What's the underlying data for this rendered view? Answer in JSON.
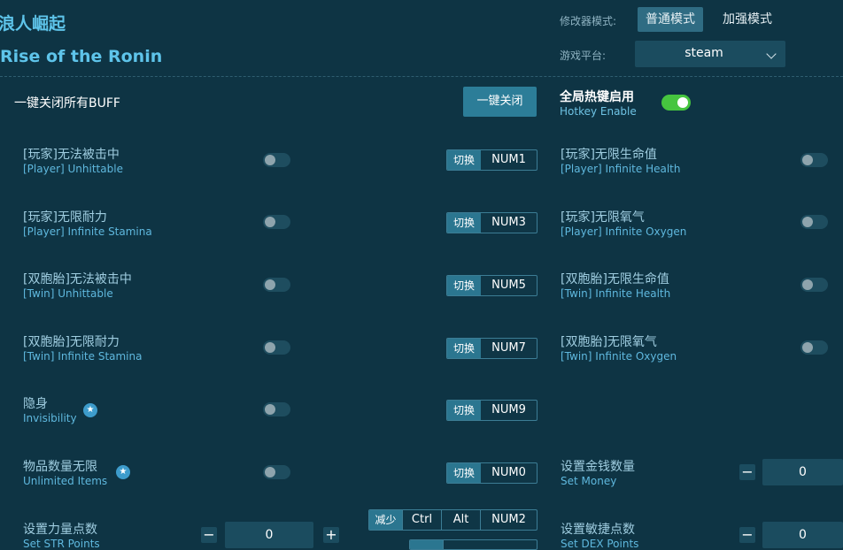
{
  "header": {
    "title_cn": "浪人崛起",
    "title_en": "Rise of the Ronin",
    "mode_label": "修改器模式:",
    "mode_normal": "普通模式",
    "mode_enhanced": "加强模式",
    "platform_label": "游戏平台:",
    "platform_value": "steam"
  },
  "controls": {
    "close_all_label": "一键关闭所有BUFF",
    "close_all_button": "一键关闭",
    "hotkey_enable_cn": "全局热键启用",
    "hotkey_enable_en": "Hotkey Enable"
  },
  "hotkey_switch_label": "切换",
  "left_rows": [
    {
      "cn": "[玩家]无法被击中",
      "en": "[Player] Unhittable",
      "key": "NUM1"
    },
    {
      "cn": "[玩家]无限耐力",
      "en": "[Player] Infinite Stamina",
      "key": "NUM3"
    },
    {
      "cn": "[双胞胎]无法被击中",
      "en": "[Twin] Unhittable",
      "key": "NUM5"
    },
    {
      "cn": "[双胞胎]无限耐力",
      "en": "[Twin] Infinite Stamina",
      "key": "NUM7"
    },
    {
      "cn": "隐身",
      "en": "Invisibility",
      "key": "NUM9"
    },
    {
      "cn": "物品数量无限",
      "en": "Unlimited Items",
      "key": "NUM0"
    }
  ],
  "right_rows": [
    {
      "cn": "[玩家]无限生命值",
      "en": "[Player] Infinite Health"
    },
    {
      "cn": "[玩家]无限氧气",
      "en": "[Player] Infinite Oxygen"
    },
    {
      "cn": "[双胞胎]无限生命值",
      "en": "[Twin] Infinite Health"
    },
    {
      "cn": "[双胞胎]无限氧气",
      "en": "[Twin] Infinite Oxygen"
    }
  ],
  "set_money": {
    "cn": "设置金钱数量",
    "en": "Set Money",
    "value": "0",
    "minus": "−"
  },
  "set_str": {
    "cn": "设置力量点数",
    "en": "Set STR Points",
    "value": "0",
    "minus": "−",
    "plus": "+"
  },
  "set_dex": {
    "cn": "设置敏捷点数",
    "en": "Set DEX Points",
    "value": "0",
    "minus": "−"
  },
  "str_hotkey": {
    "label": "减少",
    "k1": "Ctrl",
    "k2": "Alt",
    "k3": "NUM2"
  },
  "icons": {
    "star": "★"
  }
}
